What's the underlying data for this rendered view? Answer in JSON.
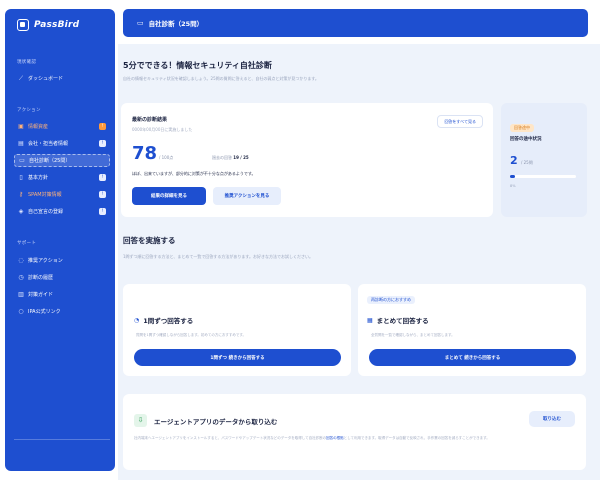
{
  "app": {
    "name": "PassBird"
  },
  "sidebar": {
    "sections": [
      {
        "label": "現状確認"
      },
      {
        "label": "アクション"
      },
      {
        "label": "サポート"
      }
    ],
    "top_items": [
      {
        "label": "ダッシュボード",
        "icon": "chart-line-icon"
      }
    ],
    "action_items": [
      {
        "label": "情報資産",
        "icon": "box-icon",
        "badge": "!",
        "alert": true
      },
      {
        "label": "会社・担当者情報",
        "icon": "building-icon",
        "badge": "!",
        "alert": false
      },
      {
        "label": "自社診断（25問）",
        "icon": "clipboard-icon",
        "badge": "",
        "alert": false,
        "active": true
      },
      {
        "label": "基本方針",
        "icon": "document-icon",
        "badge": "!",
        "alert": false
      },
      {
        "label": "SPAM対策情報",
        "icon": "key-icon",
        "badge": "!",
        "alert": true
      },
      {
        "label": "自己宣言の登録",
        "icon": "shield-icon",
        "badge": "!",
        "alert": false
      }
    ],
    "support_items": [
      {
        "label": "推奨アクション",
        "icon": "lightbulb-icon"
      },
      {
        "label": "診断の履歴",
        "icon": "history-icon"
      },
      {
        "label": "対策ガイド",
        "icon": "book-icon"
      },
      {
        "label": "IPA公式リンク",
        "icon": "link-icon"
      }
    ]
  },
  "topbar": {
    "title": "自社診断（25問）",
    "icon": "clipboard-icon"
  },
  "intro": {
    "title": "5分でできる！情報セキュリティ自社診断",
    "description": "自社の情報セキュリティ状況を確認しましょう。25問の質問に答えると、自社の弱点と対策が見つかります。"
  },
  "results": {
    "title": "最新の診断結果",
    "subtitle": "0000年00月00日に実施しました",
    "view_all_label": "回答をすべて見る",
    "score": "78",
    "score_unit": "/ 100点",
    "progress_label": "過去の回答",
    "progress_value": "19 / 25",
    "message": "ほぼ、出来ていますが、部分的に対策が不十分な点があるようです。",
    "details_button": "結果の詳細を見る",
    "actions_button": "推奨アクションを見る"
  },
  "peek_card": {
    "badge": "回答途中",
    "title": "回答の途中状況",
    "count": "2",
    "count_unit": "/ 25問",
    "progress": 0.08,
    "footer": "8%"
  },
  "answer_section": {
    "title": "回答を実施する",
    "description": "1問ずつ順に回答する方法と、まとめて一覧で回答する方法があります。お好きな方法でお試しください。"
  },
  "answer_cards": [
    {
      "badge": "",
      "icon": "chat-icon",
      "title": "1問ずつ回答する",
      "description": "質問を1問ずつ確認しながら回答します。初めての方におすすめです。",
      "button": "1問ずつ 続きから回答する"
    },
    {
      "badge": "再診断の方におすすめ",
      "icon": "list-icon",
      "title": "まとめて回答する",
      "description": "全質問を一覧で確認しながら、まとめて回答します。",
      "button": "まとめて 続きから回答する"
    }
  ],
  "agent_card": {
    "icon": "import-icon",
    "title": "エージェントアプリのデータから取り込む",
    "button": "取り込む",
    "description": "社内端末へエージェントアプリをインストールすると、パスワードやアップデート状況などのデータを取得して自社診断の",
    "highlight": "回答の根拠",
    "description_tail": "として利用できます。取得データは自動で反映され、手作業の回答を減らすことができます。"
  },
  "colors": {
    "brand": "#1e4fd0",
    "alert": "#ff9a3c",
    "background": "#eef3fb"
  }
}
